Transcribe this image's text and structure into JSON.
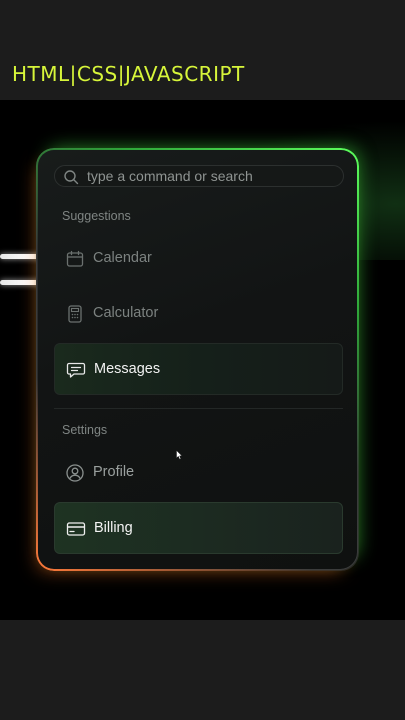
{
  "header": {
    "title": "HTML|CSS|JAVASCRIPT"
  },
  "search": {
    "placeholder": "type a command or search"
  },
  "suggestions": {
    "label": "Suggestions",
    "items": [
      {
        "label": "Calendar",
        "icon": "calendar-icon"
      },
      {
        "label": "Calculator",
        "icon": "calculator-icon"
      },
      {
        "label": "Messages",
        "icon": "message-icon"
      }
    ]
  },
  "settings": {
    "label": "Settings",
    "items": [
      {
        "label": "Profile",
        "icon": "profile-icon"
      },
      {
        "label": "Billing",
        "icon": "credit-card-icon"
      }
    ]
  },
  "colors": {
    "accent_title": "#d7f53a",
    "glow_green": "#5cff5c",
    "glow_orange": "#ff7a3a"
  }
}
